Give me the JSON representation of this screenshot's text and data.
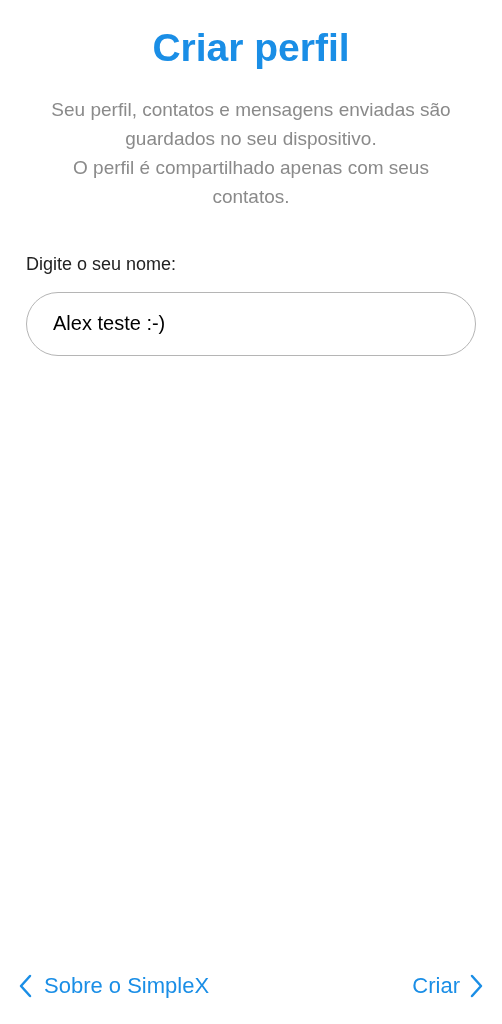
{
  "title": "Criar perfil",
  "description": [
    "Seu perfil, contatos e mensagens enviadas são guardados no seu dispositivo.",
    "O perfil é compartilhado apenas com seus contatos."
  ],
  "name_field": {
    "label": "Digite o seu nome:",
    "value": "Alex teste :-)"
  },
  "footer": {
    "back": "Sobre o SimpleX",
    "next": "Criar"
  }
}
